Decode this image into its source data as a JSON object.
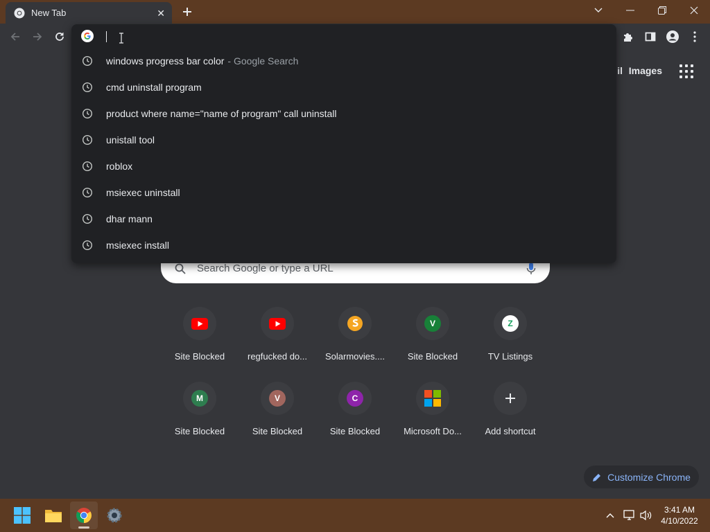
{
  "browser": {
    "tab": {
      "title": "New Tab",
      "favicon": "chrome-icon"
    },
    "window_controls": [
      "tab-search-icon",
      "minimize-icon",
      "restore-icon",
      "close-icon"
    ]
  },
  "toolbar": {
    "icons": [
      "back-icon",
      "forward-icon",
      "reload-icon",
      "extensions-icon",
      "side-panel-icon",
      "profile-icon",
      "menu-icon"
    ]
  },
  "omnibox": {
    "value": "",
    "suggestions": [
      {
        "text": "windows progress bar color",
        "description": "- Google Search"
      },
      {
        "text": "cmd uninstall program",
        "description": ""
      },
      {
        "text": "product where name=\"name of program\" call uninstall",
        "description": ""
      },
      {
        "text": "unistall tool",
        "description": ""
      },
      {
        "text": "roblox",
        "description": ""
      },
      {
        "text": "msiexec uninstall",
        "description": ""
      },
      {
        "text": "dhar mann",
        "description": ""
      },
      {
        "text": "msiexec install",
        "description": ""
      }
    ]
  },
  "ntp": {
    "header_links": {
      "gmail_partial": "il",
      "images": "Images"
    },
    "search": {
      "placeholder": "Search Google or type a URL"
    },
    "shortcuts": [
      {
        "title": "Site Blocked",
        "icon": "youtube-icon"
      },
      {
        "title": "regfucked do...",
        "icon": "youtube-icon"
      },
      {
        "title": "Solarmovies....",
        "icon": "solarmovies-icon"
      },
      {
        "title": "Site Blocked",
        "icon": "letter-icon",
        "letter": "V",
        "color": "#188038"
      },
      {
        "title": "TV Listings",
        "icon": "zap2it-icon",
        "letter": "Z"
      },
      {
        "title": "Site Blocked",
        "icon": "letter-icon",
        "letter": "M",
        "color": "#2e7d4f"
      },
      {
        "title": "Site Blocked",
        "icon": "letter-icon",
        "letter": "V",
        "color": "#a1665e"
      },
      {
        "title": "Site Blocked",
        "icon": "letter-icon",
        "letter": "C",
        "color": "#8e24aa"
      },
      {
        "title": "Microsoft Do...",
        "icon": "microsoft-icon"
      },
      {
        "title": "Add shortcut",
        "icon": "plus-icon"
      }
    ],
    "customize_label": "Customize Chrome"
  },
  "taskbar": {
    "apps": [
      "windows-start-icon",
      "file-explorer-icon",
      "chrome-icon",
      "settings-icon"
    ],
    "tray": [
      "chevron-up-icon",
      "network-icon",
      "volume-icon"
    ],
    "time": "3:41 AM",
    "date": "4/10/2022"
  },
  "colors": {
    "titlebar": "#5c3a22",
    "toolbar": "#35363a",
    "ntp_background": "#35363a",
    "popup": "#202124",
    "accent_blue": "#8ab4f8"
  }
}
